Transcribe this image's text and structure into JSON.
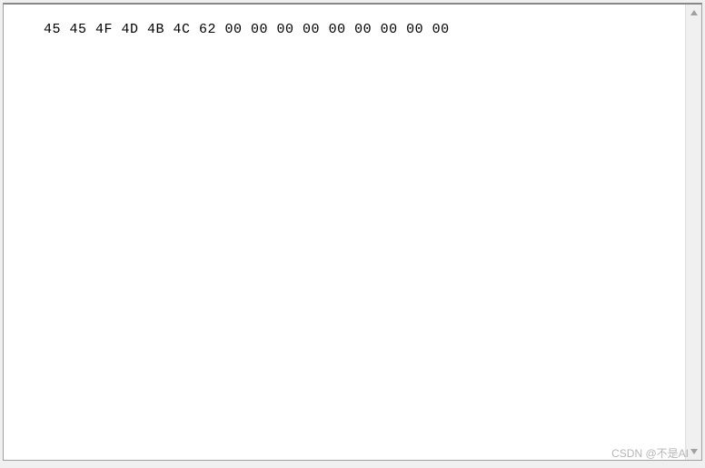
{
  "content": {
    "hex_line": "45 45 4F 4D 4B 4C 62 00 00 00 00 00 00 00 00 00"
  },
  "watermark": {
    "text": "CSDN @不是AI"
  }
}
